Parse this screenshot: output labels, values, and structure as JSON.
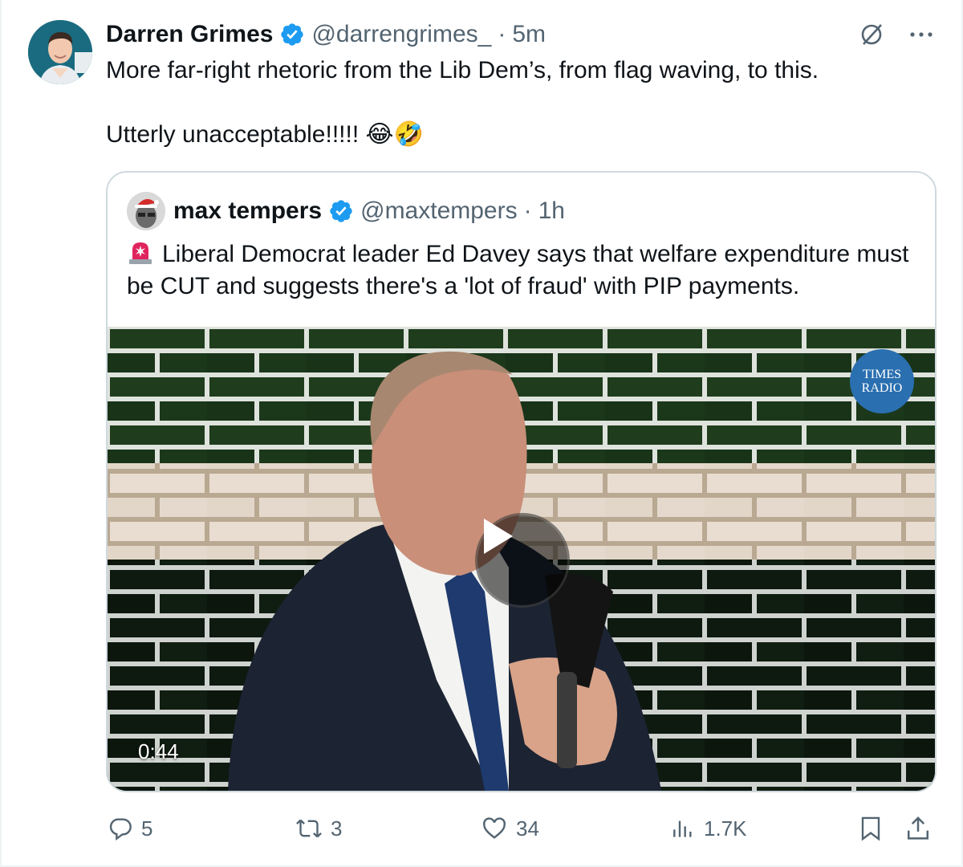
{
  "tweet": {
    "author_name": "Darren Grimes",
    "author_handle": "@darrengrimes_",
    "separator": "·",
    "time": "5m",
    "text": "More far-right rhetoric from the Lib Dem’s, from flag waving, to this.\n\nUtterly unacceptable!!!!! 😂🤣"
  },
  "quoted": {
    "author_name": "max tempers",
    "author_handle": "@maxtempers",
    "separator": "·",
    "time": "1h",
    "text": "Liberal Democrat leader Ed Davey says that welfare expenditure must be CUT and suggests there's a 'lot of fraud' with PIP payments.",
    "video": {
      "duration": "0:44",
      "logo_line1": "TIMES",
      "logo_line2": "RADIO"
    }
  },
  "actions": {
    "replies": "5",
    "reposts": "3",
    "likes": "34",
    "views": "1.7K"
  },
  "colors": {
    "text": "#0f1419",
    "secondary": "#536471",
    "verified": "#1d9bf0",
    "border": "#cfd9de"
  },
  "icons": [
    "verified-badge-icon",
    "grok-icon",
    "more-icon",
    "siren-icon",
    "play-icon",
    "reply-icon",
    "repost-icon",
    "like-icon",
    "views-icon",
    "bookmark-icon",
    "share-icon"
  ]
}
